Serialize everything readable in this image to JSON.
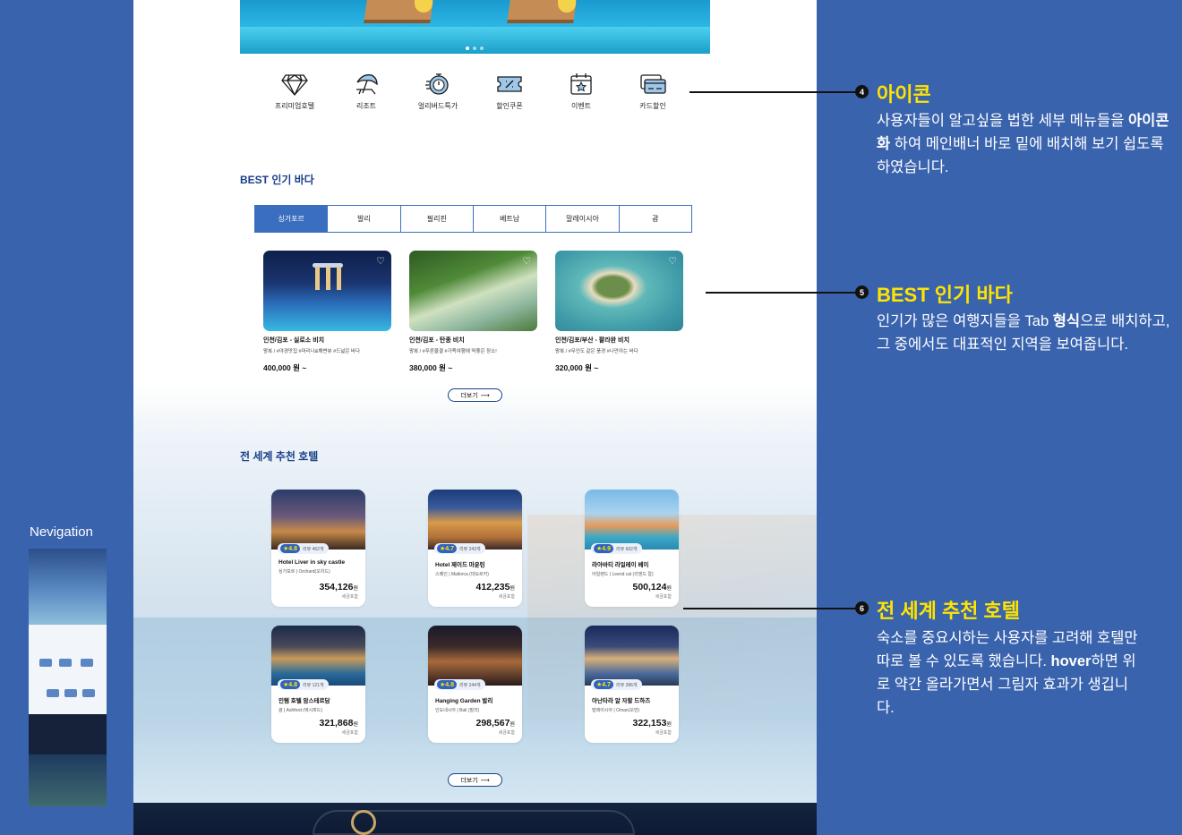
{
  "icons": [
    {
      "label": "프리미엄호텔",
      "icon": "diamond-icon"
    },
    {
      "label": "리조트",
      "icon": "beach-umbrella-icon"
    },
    {
      "label": "얼리버드특가",
      "icon": "stopwatch-icon"
    },
    {
      "label": "할인쿠폰",
      "icon": "coupon-icon"
    },
    {
      "label": "이벤트",
      "icon": "calendar-star-icon"
    },
    {
      "label": "카드할인",
      "icon": "credit-card-icon"
    }
  ],
  "best": {
    "title": "BEST 인기 바다",
    "tabs": [
      "싱가포르",
      "발리",
      "필리핀",
      "베트남",
      "말레이시아",
      "괌"
    ],
    "active_tab": "싱가포르",
    "cards": [
      {
        "title": "인천/김포 - 실로소 비치",
        "sub": "왕복 / #야경맛집 #마리나&해변뷰 #드넓은 바다",
        "price": "400,000 원 ~"
      },
      {
        "title": "인천/김포 - 탄종 비치",
        "sub": "왕복 / #푸른물결 #가족여행에 딱좋은 장소!",
        "price": "380,000 원 ~"
      },
      {
        "title": "인천/김포/부산 - 팔라완 비치",
        "sub": "왕복 / #무인도 같은 풍경 #나만아는 바다",
        "price": "320,000 원 ~"
      }
    ],
    "more": "더보기"
  },
  "hotels": {
    "title": "전 세계 추천 호텔",
    "items": [
      {
        "rating": "4.8",
        "reviews": "리뷰 462개",
        "name": "Hotel Liver in sky castle",
        "loc": "싱가포르  |  Orchard(오차드)",
        "price": "354,126",
        "unit": "원",
        "tax": "세금포함"
      },
      {
        "rating": "4.7",
        "reviews": "리뷰 243개",
        "name": "Hotel 제이드 마운틴",
        "loc": "스페인  |  Mallorca (마요르카)",
        "price": "412,235",
        "unit": "원",
        "tax": "세금포함"
      },
      {
        "rating": "4.9",
        "reviews": "리뷰 602개",
        "name": "라아바티 라일레이 베이",
        "loc": "아일랜드 | Leend cal (리앤드 칼)",
        "price": "500,124",
        "unit": "원",
        "tax": "세금포함"
      },
      {
        "rating": "4.8",
        "reviews": "리뷰 121개",
        "name": "인템 호텔 암스테르담",
        "loc": "괌 | Ashford (애시퍼드)",
        "price": "321,868",
        "unit": "원",
        "tax": "세금포함"
      },
      {
        "rating": "4.8",
        "reviews": "리뷰 244개",
        "name": "Hanging Garden 발리",
        "loc": "인도네시아 | Bali (발리)",
        "price": "298,567",
        "unit": "원",
        "tax": "세금포함"
      },
      {
        "rating": "4.7",
        "reviews": "리뷰 286개",
        "name": "아난타라 알 자할 드하즈",
        "loc": "말레이시아 | Oman(오만)",
        "price": "322,153",
        "unit": "원",
        "tax": "세금포함"
      }
    ],
    "more": "더보기"
  },
  "annotations": [
    {
      "num": "4",
      "title": "아이콘",
      "desc_pre": "사용자들이 알고싶을 법한 세부 메뉴들을 ",
      "desc_bold": "아이콘화",
      "desc_post": " 하여 메인배너 바로 밑에 배치해 보기 쉽도록 하였습니다."
    },
    {
      "num": "5",
      "title": "BEST 인기 바다",
      "desc_pre": "인기가 많은 여행지들을 Tab ",
      "desc_bold": "형식",
      "desc_post": "으로 배치하고, 그 중에서도 대표적인 지역을 보여줍니다."
    },
    {
      "num": "6",
      "title": "전 세계 추천 호텔",
      "desc_pre": "숙소를 중요시하는 사용자를 고려해 호텔만 따로 볼 수 있도록 했습니다. ",
      "desc_bold": "hover",
      "desc_post": "하면 위로 약간 올라가면서 그림자 효과가 생깁니다."
    }
  ],
  "navigation": {
    "label": "Nevigation"
  },
  "colors": {
    "background": "#3a63ae",
    "accent": "#ffe400",
    "primary": "#3a6fc0"
  }
}
